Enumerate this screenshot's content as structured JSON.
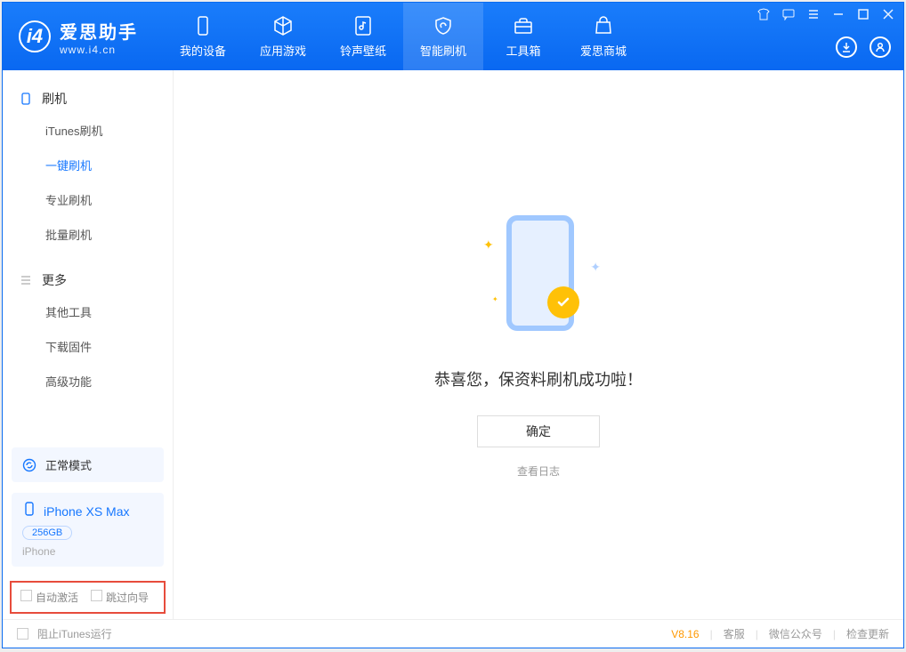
{
  "app": {
    "title": "爱思助手",
    "subtitle": "www.i4.cn"
  },
  "tabs": {
    "device": "我的设备",
    "apps": "应用游戏",
    "ringtone": "铃声壁纸",
    "flash": "智能刷机",
    "tools": "工具箱",
    "store": "爱思商城"
  },
  "sidebar": {
    "section_flash": "刷机",
    "items_flash": [
      "iTunes刷机",
      "一键刷机",
      "专业刷机",
      "批量刷机"
    ],
    "section_more": "更多",
    "items_more": [
      "其他工具",
      "下载固件",
      "高级功能"
    ]
  },
  "mode": {
    "label": "正常模式"
  },
  "device": {
    "name": "iPhone XS Max",
    "storage": "256GB",
    "type": "iPhone"
  },
  "options": {
    "auto_activate": "自动激活",
    "skip_wizard": "跳过向导"
  },
  "main": {
    "success_msg": "恭喜您，保资料刷机成功啦！",
    "ok_button": "确定",
    "view_log": "查看日志"
  },
  "footer": {
    "block_itunes": "阻止iTunes运行",
    "version": "V8.16",
    "support": "客服",
    "wechat": "微信公众号",
    "update": "检查更新"
  }
}
